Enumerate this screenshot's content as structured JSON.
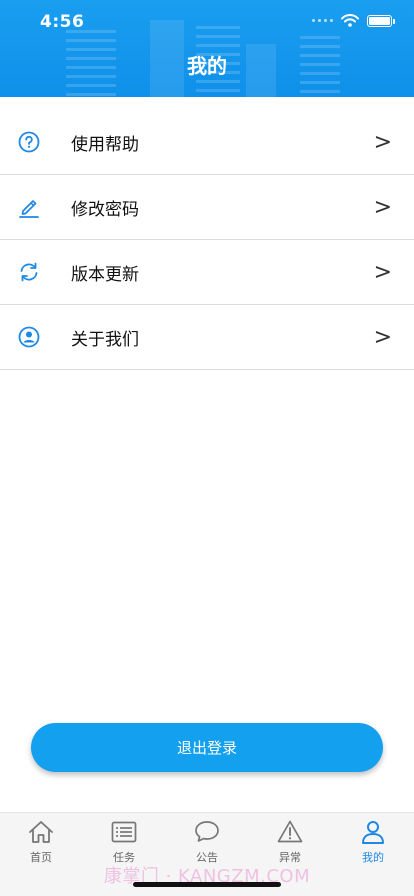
{
  "status_bar": {
    "time": "4:56"
  },
  "header": {
    "title": "我的"
  },
  "menu": {
    "items": [
      {
        "label": "使用帮助",
        "icon": "help-circle-icon",
        "chevron": ">"
      },
      {
        "label": "修改密码",
        "icon": "edit-pencil-icon",
        "chevron": ">"
      },
      {
        "label": "版本更新",
        "icon": "refresh-icon",
        "chevron": ">"
      },
      {
        "label": "关于我们",
        "icon": "user-circle-icon",
        "chevron": ">"
      }
    ]
  },
  "logout": {
    "label": "退出登录"
  },
  "tabbar": {
    "tabs": [
      {
        "label": "首页",
        "icon": "home-icon"
      },
      {
        "label": "任务",
        "icon": "task-list-icon"
      },
      {
        "label": "公告",
        "icon": "chat-bubble-icon"
      },
      {
        "label": "异常",
        "icon": "warning-icon"
      },
      {
        "label": "我的",
        "icon": "user-icon",
        "active": true
      }
    ]
  },
  "watermark": "康掌门 · KANGZM.COM",
  "colors": {
    "brand": "#13a0ef",
    "active_tab": "#1e88e5",
    "inactive_tab": "#777777"
  }
}
